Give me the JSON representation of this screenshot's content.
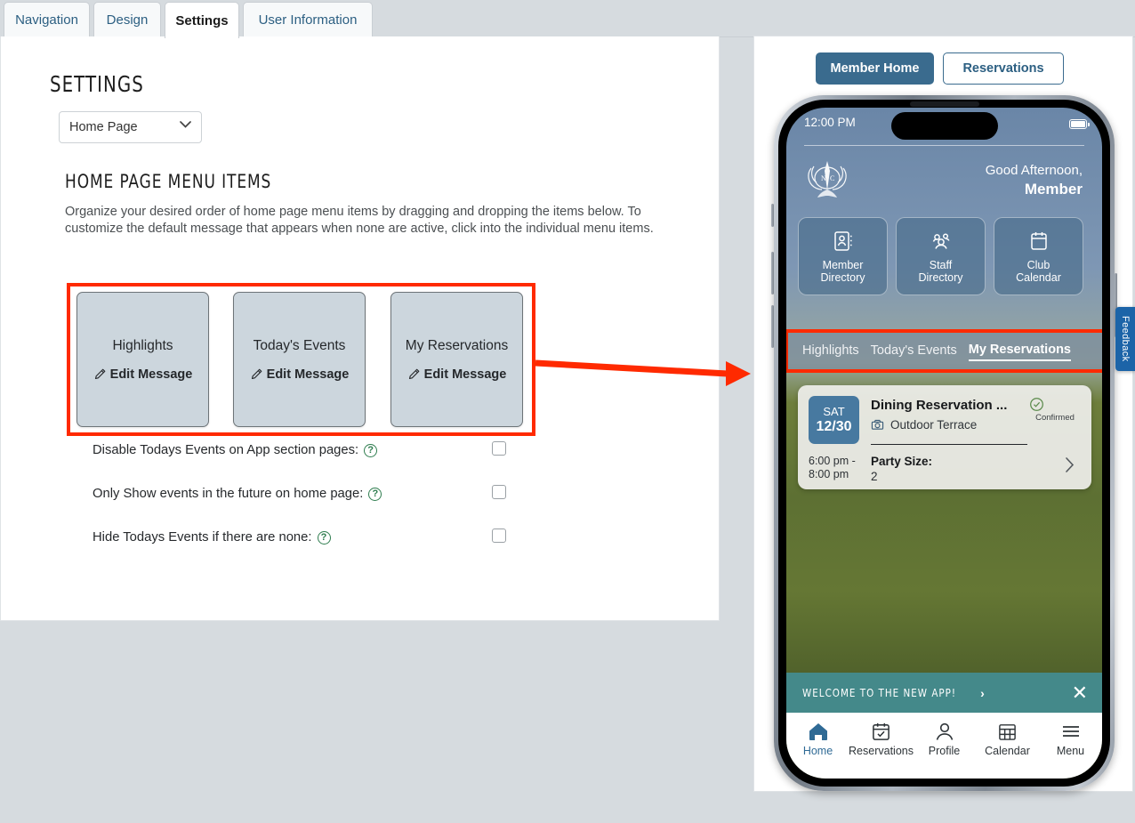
{
  "tabs": [
    {
      "label": "Navigation",
      "active": false
    },
    {
      "label": "Design",
      "active": false
    },
    {
      "label": "Settings",
      "active": true
    },
    {
      "label": "User Information",
      "active": false
    }
  ],
  "settings": {
    "page_title": "SETTINGS",
    "page_select": {
      "value": "Home Page",
      "options": [
        "Home Page"
      ]
    },
    "section": {
      "title": "HOME PAGE MENU ITEMS",
      "description": "Organize your desired order of home page menu items by dragging and dropping the items below. To customize the default message that appears when none are active, click into the individual menu items."
    },
    "menu_items": [
      {
        "title": "Highlights",
        "edit_label": "Edit Message",
        "edit_icon": "pencil-icon"
      },
      {
        "title": "Today's Events",
        "edit_label": "Edit Message",
        "edit_icon": "pencil-icon"
      },
      {
        "title": "My Reservations",
        "edit_label": "Edit Message",
        "edit_icon": "pencil-icon"
      }
    ],
    "options": [
      {
        "label": "Disable Todays Events on App section pages:",
        "help_icon": "question-mark-icon",
        "checked": false
      },
      {
        "label": "Only Show events in the future on home page:",
        "help_icon": "question-mark-icon",
        "checked": false
      },
      {
        "label": "Hide Todays Events if there are none:",
        "help_icon": "question-mark-icon",
        "checked": false
      }
    ],
    "highlight_color": "#ff2a00"
  },
  "preview": {
    "buttons": [
      {
        "label": "Member Home",
        "style": "primary"
      },
      {
        "label": "Reservations",
        "style": "ghost"
      }
    ],
    "phone": {
      "status_bar": {
        "time": "12:00 PM",
        "battery_icon": "battery-icon"
      },
      "crest_icon": "club-crest-icon",
      "greeting_line1": "Good Afternoon,",
      "greeting_line2": "Member",
      "tiles": [
        {
          "label": "Member\nDirectory",
          "line1": "Member",
          "line2": "Directory",
          "icon": "contact-book-icon"
        },
        {
          "label": "Staff\nDirectory",
          "line1": "Staff",
          "line2": "Directory",
          "icon": "people-group-icon"
        },
        {
          "label": "Club\nCalendar",
          "line1": "Club",
          "line2": "Calendar",
          "icon": "calendar-icon"
        }
      ],
      "menu_tabs": [
        {
          "label": "Highlights",
          "active": false
        },
        {
          "label": "Today's Events",
          "active": false
        },
        {
          "label": "My Reservations",
          "active": true
        }
      ],
      "reservation_card": {
        "day": "SAT",
        "date": "12/30",
        "title": "Dining Reservation ...",
        "location": "Outdoor Terrace",
        "location_icon": "dining-icon",
        "status": "Confirmed",
        "status_icon": "check-circle-icon",
        "time": "6:00 pm -\n8:00 pm",
        "time_line1": "6:00 pm -",
        "time_line2": "8:00 pm",
        "party_label": "Party Size:",
        "party_value": "2",
        "chevron_icon": "chevron-right-icon"
      },
      "welcome_banner": {
        "text": "WELCOME TO THE NEW APP!",
        "chevron_icon": "chevron-right-icon",
        "close_icon": "close-icon",
        "color": "#44898a"
      },
      "bottom_nav": [
        {
          "label": "Home",
          "icon": "home-icon",
          "active": true
        },
        {
          "label": "Reservations",
          "icon": "calendar-check-icon",
          "active": false
        },
        {
          "label": "Profile",
          "icon": "person-icon",
          "active": false
        },
        {
          "label": "Calendar",
          "icon": "calendar-grid-icon",
          "active": false
        },
        {
          "label": "Menu",
          "icon": "hamburger-menu-icon",
          "active": false
        }
      ]
    }
  },
  "feedback_tab": {
    "label": "Feedback"
  }
}
